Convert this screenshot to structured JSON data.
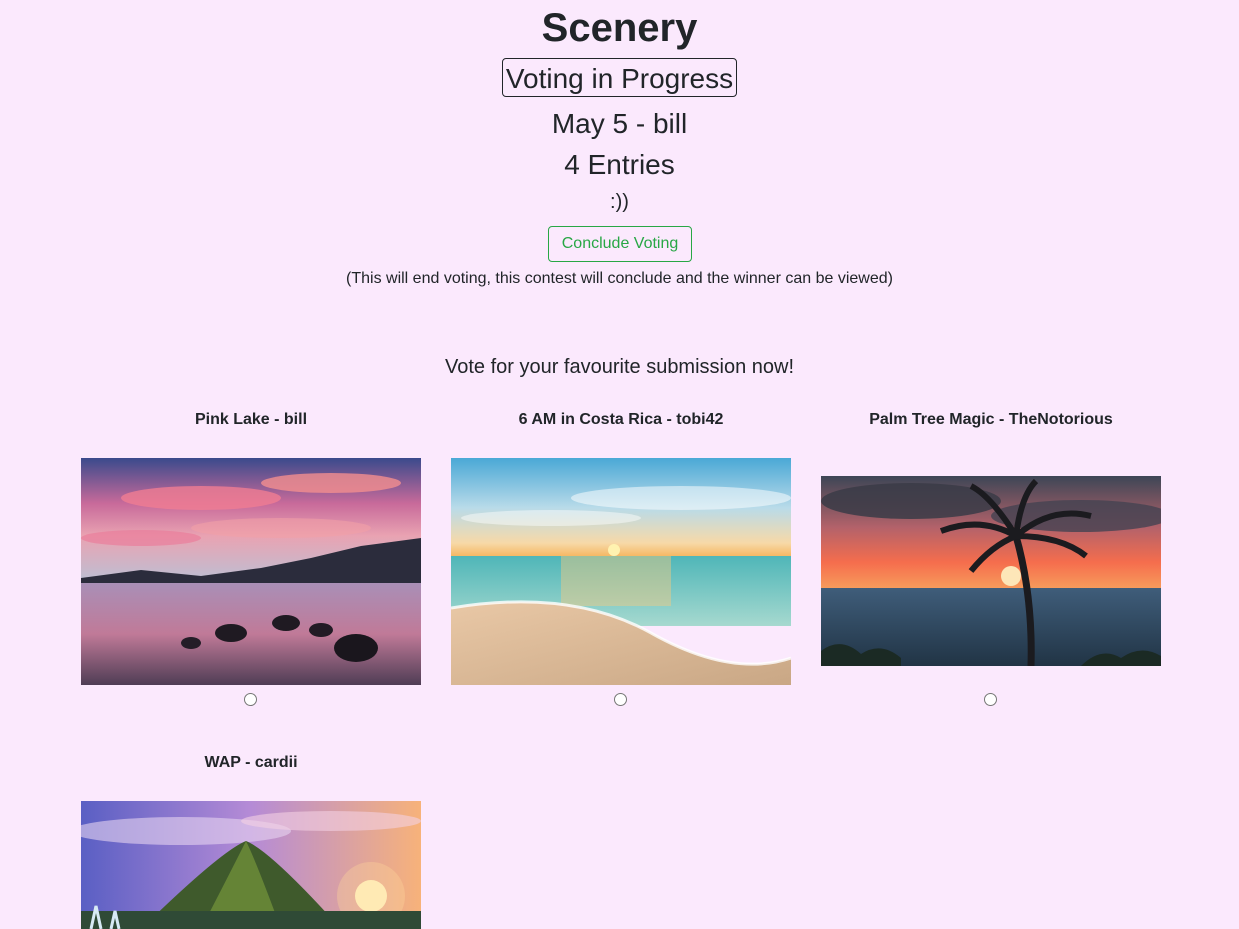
{
  "contest": {
    "title": "Scenery",
    "status": "Voting in Progress",
    "subtitle": "May 5 - bill",
    "entries_count": "4 Entries",
    "note": ":))",
    "conclude_button": "Conclude Voting",
    "conclude_hint": "(This will end voting, this contest will conclude and the winner can be viewed)",
    "vote_heading": "Vote for your favourite submission now!"
  },
  "submissions": [
    {
      "title": "Pink Lake - bill",
      "selected": false
    },
    {
      "title": "6 AM in Costa Rica - tobi42",
      "selected": false
    },
    {
      "title": "Palm Tree Magic - TheNotorious",
      "selected": false
    },
    {
      "title": "WAP - cardii",
      "selected": false
    }
  ],
  "colors": {
    "background": "#fbe9fd",
    "text": "#212529",
    "success": "#28a745"
  }
}
